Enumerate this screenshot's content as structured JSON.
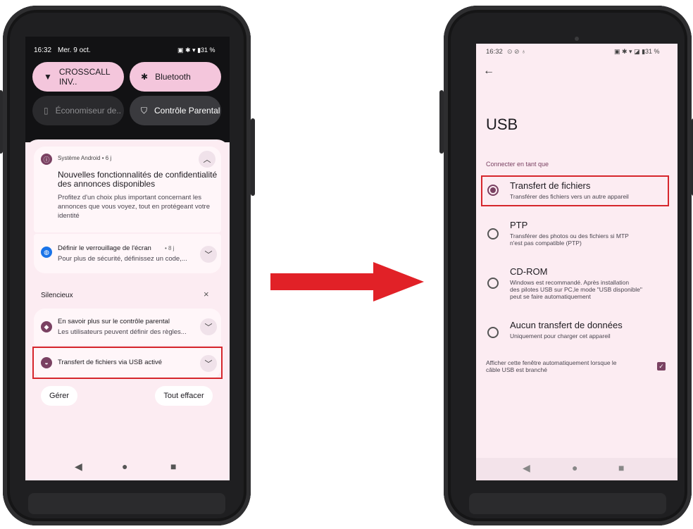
{
  "left": {
    "status_time": "16:32",
    "status_date": "Mer. 9 oct.",
    "status_icons": "▣ ✱ ▾ ▮31 %",
    "tiles": [
      {
        "icon": "wifi-icon",
        "glyph": "▼",
        "label": "CROSSCALL INV.."
      },
      {
        "icon": "bluetooth-icon",
        "glyph": "✱",
        "label": "Bluetooth"
      },
      {
        "icon": "battery-saver-icon",
        "glyph": "▯",
        "label": "Économiseur de.."
      },
      {
        "icon": "parental-control-icon",
        "glyph": "⛉",
        "label": "Contrôle Parental"
      }
    ],
    "notif1": {
      "app": "Système Android • 6 j",
      "title": "Nouvelles fonctionnalités de confidentialité des annonces disponibles",
      "body": "Profitez d'un choix plus important concernant les annonces que vous voyez, tout en protégeant votre identité"
    },
    "notif2": {
      "title": "Définir le verrouillage de l'écran",
      "age": "• 8 j",
      "body": "Pour plus de sécurité, définissez un code,..."
    },
    "silent_header": "Silencieux",
    "silent_close": "×",
    "notif3": {
      "title": "En savoir plus sur le contrôle parental",
      "body": "Les utilisateurs peuvent définir des règles..."
    },
    "notif4": {
      "title": "Transfert de fichiers via USB activé"
    },
    "manage_label": "Gérer",
    "clear_all_label": "Tout effacer",
    "nav": {
      "back": "◀",
      "home": "●",
      "recents": "■"
    }
  },
  "right": {
    "status_time": "16:32",
    "status_left_icons": "⊙ ⊘ ♁",
    "status_icons": "▣ ✱ ▾ ◪ ▮31 %",
    "back_arrow": "←",
    "page_title": "USB",
    "section_label": "Connecter en tant que",
    "options": [
      {
        "title": "Transfert de fichiers",
        "desc": "Transférer des fichiers vers un autre appareil",
        "selected": true
      },
      {
        "title": "PTP",
        "desc": "Transférer des photos ou des fichiers si MTP\nn'est pas compatible (PTP)",
        "selected": false
      },
      {
        "title": "CD-ROM",
        "desc": "Windows est recommandé. Après installation\ndes pilotes USB sur PC,le mode \"USB disponible\"\npeut se faire automatiquement",
        "selected": false
      },
      {
        "title": "Aucun transfert de données",
        "desc": "Uniquement pour charger cet appareil",
        "selected": false
      }
    ],
    "auto_show_label": "Afficher cette fenêtre automatiquement lorsque le\ncâble USB est branché",
    "auto_show_checked": true,
    "nav": {
      "back": "◀",
      "home": "●",
      "recents": "■"
    }
  },
  "colors": {
    "highlight": "#d6262c",
    "accent": "#7a4162",
    "screen_bg": "#fcecf2",
    "arrow": "#e12127"
  }
}
